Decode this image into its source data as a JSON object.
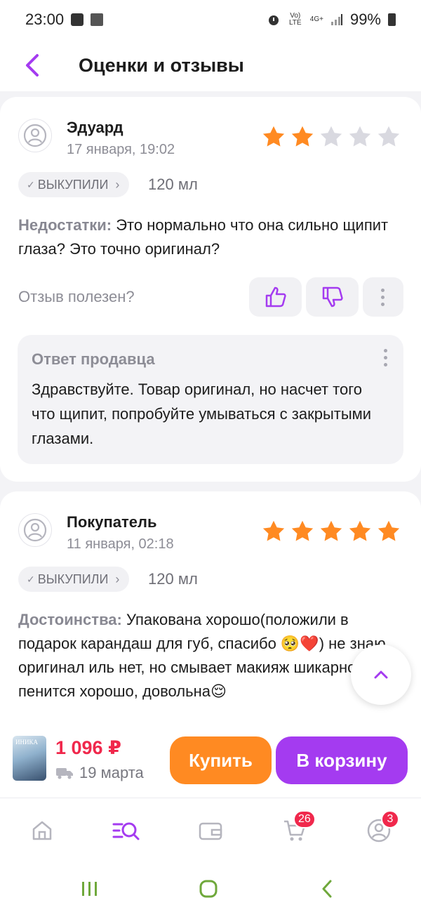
{
  "status_bar": {
    "time": "23:00",
    "network_volte": "Vo) LTE",
    "network_4g": "4G+",
    "battery": "99%"
  },
  "header": {
    "title": "Оценки и отзывы"
  },
  "reviews": [
    {
      "author": "Эдуард",
      "date": "17 января, 19:02",
      "rating": 2,
      "max_rating": 5,
      "purchased_label": "выкупили",
      "volume": "120 мл",
      "text_label": "Недостатки:",
      "text": " Это нормально что она сильно щипит глаза? Это точно оригинал?",
      "helpful_question": "Отзыв полезен?",
      "seller_reply": {
        "title": "Ответ продавца",
        "text": "Здравствуйте. Товар оригинал, но насчет того что щипит, попробуйте умываться с закрытыми глазами."
      }
    },
    {
      "author": "Покупатель",
      "date": "11 января, 02:18",
      "rating": 5,
      "max_rating": 5,
      "purchased_label": "выкупили",
      "volume": "120 мл",
      "text_label": "Достоинства:",
      "text": " Упакована хорошо(положили в подарок карандаш для губ, спасибо 🥺❤️) не знаю оригинал иль нет, но смывает макияж шикарно, пенится хорошо, довольна😌"
    }
  ],
  "product": {
    "thumb_text": "ИНИКА",
    "price": "1 096 ₽",
    "delivery": "19 марта",
    "buy_label": "Купить",
    "cart_label": "В корзину"
  },
  "tabbar": {
    "items": [
      {
        "icon": "home-icon"
      },
      {
        "icon": "catalog-search-icon",
        "active": true
      },
      {
        "icon": "wallet-icon"
      },
      {
        "icon": "cart-icon",
        "badge": "26"
      },
      {
        "icon": "profile-icon",
        "badge": "3"
      }
    ]
  },
  "colors": {
    "accent": "#a43bf0",
    "star": "#ff8a22",
    "star_empty": "#d9d9e0",
    "price": "#f0284c",
    "buy_button": "#ff8a22",
    "cart_button": "#a43bf0"
  }
}
